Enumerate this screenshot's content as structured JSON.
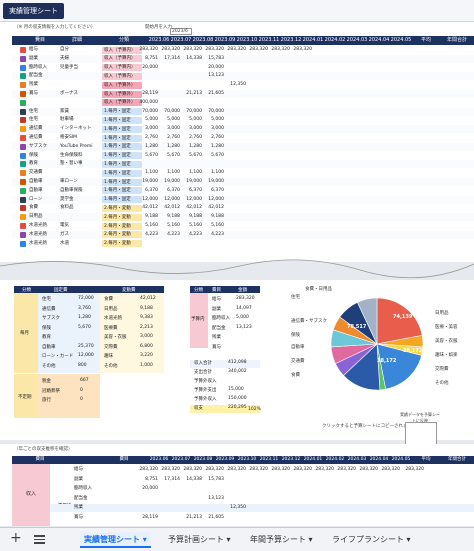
{
  "sheet_title": "実績管理シート",
  "notes": {
    "top_left": "（※ 月の収支情報を入力してください）",
    "top_right": "開始月を入力"
  },
  "start_month": "2023/6",
  "table1": {
    "headers": [
      "費目",
      "詳細",
      "分類",
      "2023.06",
      "2023.07",
      "2023.08",
      "2023.09",
      "2023.10",
      "2023.11",
      "2023.12",
      "2024.01",
      "2024.02",
      "2024.03",
      "2024.04",
      "2024.05",
      "平均",
      "年間合計"
    ],
    "rows": [
      {
        "main": "給与",
        "sub": "自分",
        "kind": "収入（予算内）",
        "vals": [
          "283,320",
          "283,320",
          "283,320",
          "283,320",
          "283,320",
          "283,320",
          "283,320",
          "283,320"
        ]
      },
      {
        "main": "副業",
        "sub": "夫婦",
        "kind": "収入（予算内）",
        "vals": [
          "8,751",
          "17,314",
          "14,338",
          "15,783"
        ]
      },
      {
        "main": "臨時収入",
        "sub": "児童手当",
        "kind": "収入（予算内）",
        "vals": [
          "20,000",
          "",
          "",
          "20,000"
        ]
      },
      {
        "main": "配当金",
        "sub": "",
        "kind": "収入（予算内）",
        "vals": [
          "",
          "",
          "",
          "13,123"
        ]
      },
      {
        "main": "残業",
        "sub": "",
        "kind": "収入（予算外）",
        "vals": [
          "",
          "",
          "",
          "",
          "12,350"
        ]
      },
      {
        "main": "賞与",
        "sub": "ボーナス",
        "kind": "収入（予算外）",
        "vals": [
          "28,119",
          "",
          "21,213",
          "21,605"
        ]
      },
      {
        "main": "",
        "sub": "",
        "kind": "収入（予算外）",
        "vals": [
          "400,000"
        ]
      },
      {
        "main": "住宅",
        "sub": "家賃",
        "kind": "1.毎月・固定",
        "vals": [
          "70,000",
          "70,000",
          "70,000",
          "70,000"
        ]
      },
      {
        "main": "住宅",
        "sub": "駐車場",
        "kind": "1.毎月・固定",
        "vals": [
          "5,000",
          "5,000",
          "5,000",
          "5,000"
        ]
      },
      {
        "main": "通信費",
        "sub": "インターネット",
        "kind": "1.毎月・固定",
        "vals": [
          "3,000",
          "3,000",
          "3,000",
          "3,000"
        ]
      },
      {
        "main": "通信費",
        "sub": "格安SIM",
        "kind": "1.毎月・固定",
        "vals": [
          "2,760",
          "2,760",
          "2,760",
          "2,760"
        ]
      },
      {
        "main": "サブスク",
        "sub": "YouTube Premi",
        "kind": "1.毎月・固定",
        "vals": [
          "1,280",
          "1,280",
          "1,280",
          "1,280"
        ]
      },
      {
        "main": "保険",
        "sub": "生命保険料",
        "kind": "1.毎月・固定",
        "vals": [
          "5,670",
          "5,670",
          "5,670",
          "5,670"
        ]
      },
      {
        "main": "教育",
        "sub": "塾・習い事",
        "kind": "1.毎月・固定",
        "vals": [
          "",
          "",
          "",
          ""
        ]
      },
      {
        "main": "交通費",
        "sub": "",
        "kind": "1.毎月・固定",
        "vals": [
          "1,100",
          "1,100",
          "1,100",
          "1,100"
        ]
      },
      {
        "main": "自動車",
        "sub": "車ローン",
        "kind": "1.毎月・固定",
        "vals": [
          "19,000",
          "19,000",
          "19,000",
          "19,000"
        ]
      },
      {
        "main": "自動車",
        "sub": "自動車保険",
        "kind": "1.毎月・固定",
        "vals": [
          "6,370",
          "6,370",
          "6,370",
          "6,370"
        ]
      },
      {
        "main": "ローン",
        "sub": "奨学金",
        "kind": "1.毎月・固定",
        "vals": [
          "12,000",
          "12,000",
          "12,000",
          "12,000"
        ]
      },
      {
        "main": "食費",
        "sub": "食料品",
        "kind": "2.毎月・変動",
        "vals": [
          "42,012",
          "42,012",
          "42,012",
          "42,012"
        ]
      },
      {
        "main": "日用品",
        "sub": "",
        "kind": "2.毎月・変動",
        "vals": [
          "9,188",
          "9,188",
          "9,188",
          "9,188"
        ]
      },
      {
        "main": "水道光熱",
        "sub": "電気",
        "kind": "2.毎月・変動",
        "vals": [
          "5,160",
          "5,160",
          "5,160",
          "5,160"
        ]
      },
      {
        "main": "水道光熱",
        "sub": "ガス",
        "kind": "2.毎月・変動",
        "vals": [
          "4,223",
          "4,223",
          "4,223",
          "4,223"
        ]
      },
      {
        "main": "水道光熱",
        "sub": "水道",
        "kind": "2.毎月・変動",
        "vals": [
          "",
          "",
          "",
          ""
        ]
      }
    ]
  },
  "section2": {
    "left_headers": [
      "分類",
      "固定費",
      "",
      "変動費"
    ],
    "left_side_labels": [
      "毎月",
      "不定期"
    ],
    "fixed_items": [
      {
        "label": "住宅",
        "val": "72,000"
      },
      {
        "label": "通信費",
        "val": "3,760"
      },
      {
        "label": "サブスク",
        "val": "1,280"
      },
      {
        "label": "保険",
        "val": "5,670"
      },
      {
        "label": "教育",
        "val": ""
      },
      {
        "label": "自動車",
        "val": "25,370"
      },
      {
        "label": "ローン・カード",
        "val": "12,000"
      },
      {
        "label": "その他",
        "val": "800"
      }
    ],
    "var_items": [
      {
        "label": "食費",
        "val": "42,012"
      },
      {
        "label": "日用品",
        "val": "9,188"
      },
      {
        "label": "水道光熱",
        "val": "9,383"
      },
      {
        "label": "医療費",
        "val": "2,213"
      },
      {
        "label": "美容・衣服",
        "val": "3,000"
      },
      {
        "label": "交際費",
        "val": "6,800"
      },
      {
        "label": "趣味",
        "val": "3,220"
      },
      {
        "label": "その他",
        "val": "1,000"
      }
    ],
    "irregular_items": [
      {
        "label": "税金",
        "val": "667"
      },
      {
        "label": "冠婚葬祭",
        "val": "0"
      },
      {
        "label": "旅行",
        "val": "0"
      }
    ],
    "mid_headers": [
      "分類",
      "費目",
      "金額"
    ],
    "mid_sections": [
      "予算内",
      "予算外"
    ],
    "mid_items": [
      {
        "label": "給与",
        "val": "283,320"
      },
      {
        "label": "副業",
        "val": "14,097"
      },
      {
        "label": "臨時収入",
        "val": "5,000"
      },
      {
        "label": "配当金",
        "val": "13,123"
      },
      {
        "label": "残業",
        "val": ""
      },
      {
        "label": "賞与",
        "val": ""
      }
    ],
    "mid_totals": [
      {
        "label": "収入合計",
        "val": "412,098"
      },
      {
        "label": "支出合計",
        "val": "340,002"
      },
      {
        "label": "予算外収入",
        "val": ""
      },
      {
        "label": "予算外支出",
        "val": "15,000"
      },
      {
        "label": "予算外収入",
        "val": "150,000"
      },
      {
        "label": "収支",
        "val": "220,295"
      }
    ],
    "pct": "102%",
    "pie_labels": [
      "住宅",
      "通信費・サブスク",
      "保険",
      "自動車",
      "交通費",
      "食費",
      "日用品",
      "医療・美容",
      "美容・衣服",
      "趣味・娯楽",
      "交際費",
      "その他"
    ],
    "pie_values": [
      "74,139",
      "78,517",
      "38,172",
      "38,172"
    ],
    "pie_top_label": "食費・日用品",
    "copy_note": "クリックすると予算シートにコピーされます",
    "copy_button_label": "実績データを予算シートに反映"
  },
  "section3": {
    "note": "（年ごとの収支推移を確認）",
    "headers": [
      "費目",
      "",
      "費目",
      "2023.06",
      "2023.07",
      "2023.08",
      "2023.09",
      "2023.10",
      "2023.11",
      "2023.12",
      "2024.01",
      "2024.02",
      "2024.03",
      "2024.04",
      "2024.05",
      "平均",
      "年間合計"
    ],
    "groups": [
      "収入",
      "予算内",
      "予算外"
    ],
    "rows": [
      {
        "label": "給与",
        "vals": [
          "283,320",
          "283,320",
          "283,320",
          "283,320",
          "283,320",
          "283,320",
          "283,320",
          "283,320",
          "283,320",
          "283,320",
          "283,320",
          "283,320",
          "283,320"
        ]
      },
      {
        "label": "副業",
        "vals": [
          "8,751",
          "17,314",
          "14,338",
          "15,783"
        ]
      },
      {
        "label": "臨時収入",
        "vals": [
          "20,000"
        ]
      },
      {
        "label": "配当金",
        "vals": [
          "",
          "",
          "",
          "13,123"
        ]
      },
      {
        "label": "残業",
        "vals": [
          "",
          "",
          "",
          "",
          "12,350"
        ]
      },
      {
        "label": "賞与",
        "vals": [
          "28,119",
          "",
          "21,213",
          "21,605"
        ]
      }
    ]
  },
  "tabs": [
    "実績管理シート",
    "予算計画シート",
    "年間予算シート",
    "ライフプランシート"
  ],
  "colors": {
    "header_navy": "#1e3262",
    "income_pink": "#f7c9d2",
    "fixed_blue": "#cfe3f6",
    "variable_yellow": "#fbe7a8",
    "tab_blue": "#1a73e8"
  }
}
